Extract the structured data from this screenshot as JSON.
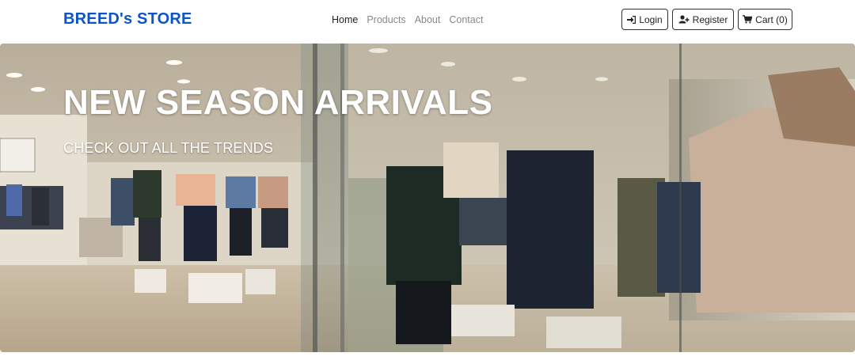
{
  "navbar": {
    "brand": "BREED's STORE",
    "links": [
      {
        "label": "Home",
        "active": true
      },
      {
        "label": "Products",
        "active": false
      },
      {
        "label": "About",
        "active": false
      },
      {
        "label": "Contact",
        "active": false
      }
    ],
    "buttons": {
      "login": {
        "label": "Login",
        "icon": "sign-in-icon"
      },
      "register": {
        "label": "Register",
        "icon": "user-plus-icon"
      },
      "cart": {
        "label": "Cart (0)",
        "icon": "shopping-cart-icon"
      }
    }
  },
  "hero": {
    "title": "NEW SEASON ARRIVALS",
    "subtitle": "CHECK OUT ALL THE TRENDS"
  },
  "colors": {
    "brand": "#0d55c4",
    "nav_active": "#222222",
    "nav_inactive": "#888888",
    "button_border": "#333333"
  }
}
